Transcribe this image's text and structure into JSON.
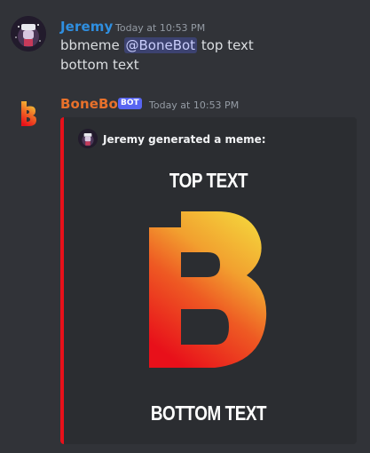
{
  "user_message": {
    "author": "Jeremy",
    "author_color": "#2f8fe0",
    "timestamp": "Today at 10:53 PM",
    "line1_prefix": "bbmeme",
    "mention": "@BoneBot",
    "line1_suffix": "top text",
    "line2": "bottom text"
  },
  "bot_message": {
    "author": "BoneBot",
    "author_color": "#e8712b",
    "bot_tag": "BOT",
    "timestamp": "Today at 10:53 PM",
    "embed": {
      "accent_color": "#e8101a",
      "author_line": "Jeremy generated a meme:",
      "meme": {
        "top_text": "TOP TEXT",
        "bottom_text": "BOTTOM TEXT",
        "image_icon": "bonebot-logo"
      }
    }
  }
}
